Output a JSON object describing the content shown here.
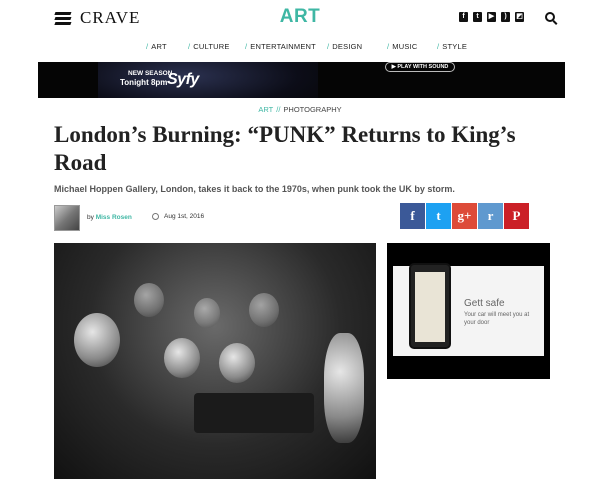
{
  "header": {
    "brand": "CRAVE",
    "section": "ART",
    "social_icons": [
      "facebook-icon",
      "twitter-icon",
      "youtube-icon",
      "rss-icon",
      "flipboard-icon"
    ]
  },
  "nav": {
    "items": [
      {
        "label": "ART"
      },
      {
        "label": "CULTURE"
      },
      {
        "label": "ENTERTAINMENT"
      },
      {
        "label": "DESIGN"
      },
      {
        "label": "MUSIC"
      },
      {
        "label": "STYLE"
      }
    ],
    "separator": "/"
  },
  "banner": {
    "line1": "NEW SEASON",
    "line2": "Tonight 8pm",
    "logo": "Syfy",
    "play_label": "▶ PLAY WITH SOUND"
  },
  "breadcrumb": {
    "category": "ART",
    "separator": "//",
    "subcategory": "PHOTOGRAPHY"
  },
  "article": {
    "title": "London’s Burning: “PUNK” Returns to King’s Road",
    "dek": "Michael Hoppen Gallery, London, takes it back to the 1970s, when punk took the UK by storm.",
    "by_prefix": "by",
    "author": "Miss Rosen",
    "date": "Aug 1st, 2016"
  },
  "share": {
    "facebook": "f",
    "twitter": "t",
    "gplus": "g+",
    "reddit": "r",
    "pinterest": "P"
  },
  "ad": {
    "headline": "Gett safe",
    "subtext": "Your car will meet you at your door"
  },
  "colors": {
    "accent": "#3fb7a4",
    "facebook": "#3b5998",
    "twitter": "#1da1f2",
    "gplus": "#dd4b39",
    "reddit": "#5f99cf",
    "pinterest": "#cb2027"
  }
}
